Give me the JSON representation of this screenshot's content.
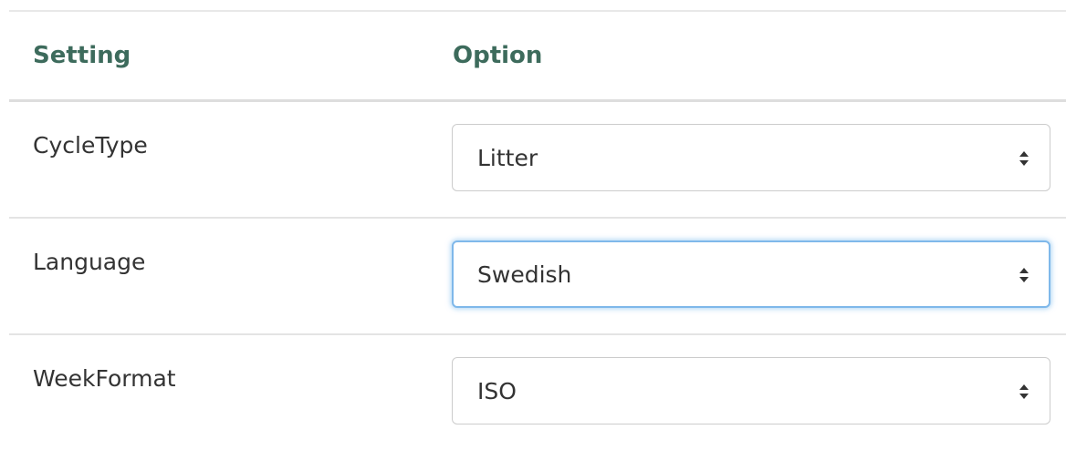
{
  "table": {
    "headers": {
      "setting": "Setting",
      "option": "Option"
    },
    "rows": [
      {
        "label": "CycleType",
        "value": "Litter",
        "focused": false
      },
      {
        "label": "Language",
        "value": "Swedish",
        "focused": true
      },
      {
        "label": "WeekFormat",
        "value": "ISO",
        "focused": false
      }
    ]
  },
  "colors": {
    "header_text": "#3d6b5c",
    "body_text": "#333333",
    "focus_ring": "#7fb8ea",
    "border": "#cccccc"
  },
  "icons": {
    "select_caret": "sort-caret-icon"
  }
}
